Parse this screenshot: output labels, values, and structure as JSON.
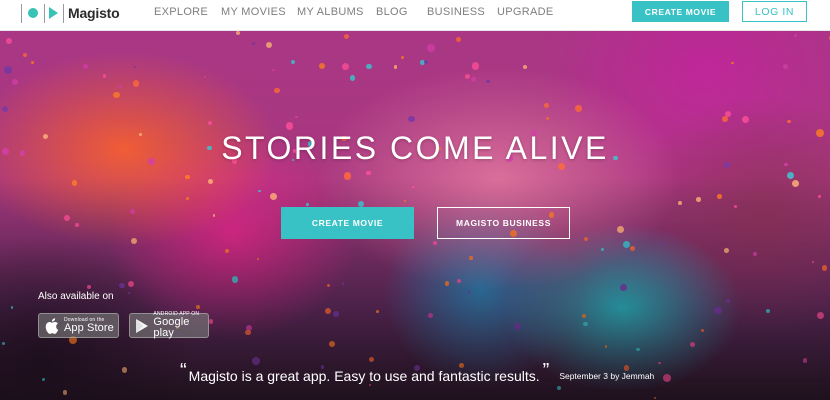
{
  "brand": {
    "name": "Magisto",
    "accent_color": "#39c2c5"
  },
  "nav": {
    "items": [
      {
        "label": "EXPLORE"
      },
      {
        "label": "MY MOVIES"
      },
      {
        "label": "MY ALBUMS"
      },
      {
        "label": "BLOG"
      },
      {
        "label": "BUSINESS"
      },
      {
        "label": "UPGRADE"
      }
    ],
    "create_movie_label": "CREATE MOVIE",
    "login_label": "LOG IN"
  },
  "hero": {
    "headline": "STORIES COME ALIVE",
    "create_movie_label": "CREATE MOVIE",
    "business_label": "MAGISTO BUSINESS",
    "also_available": "Also available on",
    "app_store": {
      "small": "Download on the",
      "big": "App Store",
      "icon": "apple-icon"
    },
    "google_play": {
      "small": "ANDROID APP ON",
      "big": "Google play",
      "icon": "google-play-icon"
    },
    "testimonial": {
      "open_quote": "“",
      "text": "Magisto is a great app. Easy to use and fantastic results.",
      "close_quote": "”",
      "attribution": "September 3 by Jemmah"
    }
  }
}
